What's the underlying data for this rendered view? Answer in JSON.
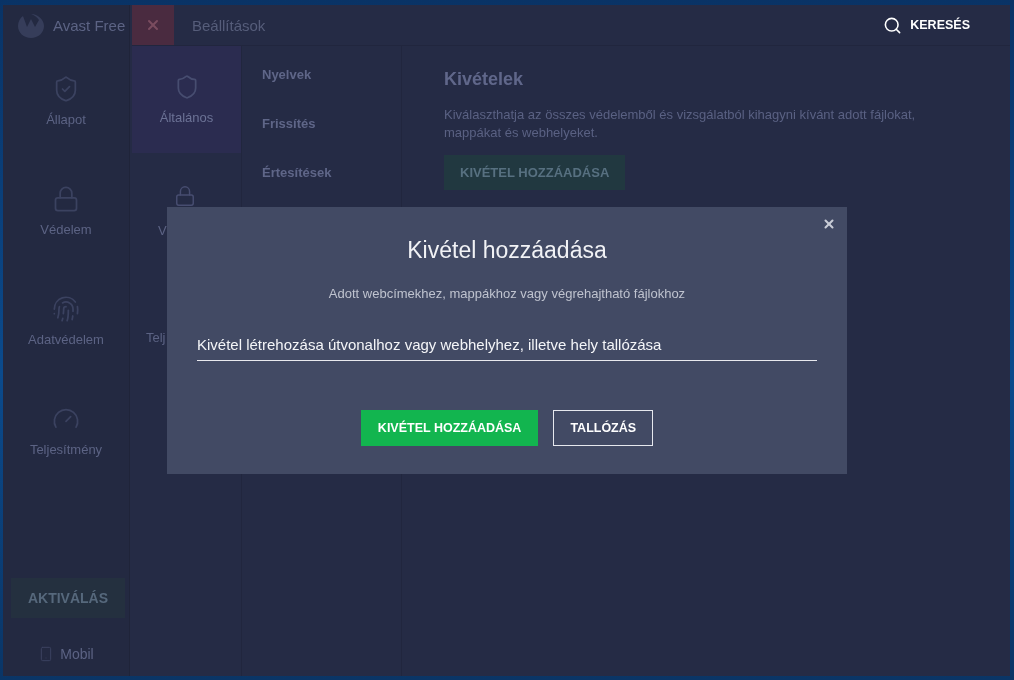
{
  "sidebar": {
    "brand": "Avast Free",
    "items": [
      {
        "label": "Állapot"
      },
      {
        "label": "Védelem"
      },
      {
        "label": "Adatvédelem"
      },
      {
        "label": "Teljesítmény"
      }
    ],
    "activate_button": "AKTIVÁLÁS",
    "mobile_link": "Mobil"
  },
  "top_bar": {
    "title": "Beállítások",
    "search": "KERESÉS"
  },
  "categories": [
    {
      "label": "Általános",
      "selected": true
    },
    {
      "label": "V",
      "selected": false
    },
    {
      "label": "Telj",
      "selected": false
    }
  ],
  "subcategories": [
    {
      "label": "Nyelvek",
      "selected": false
    },
    {
      "label": "Frissítés",
      "selected": false
    },
    {
      "label": "Értesítések",
      "selected": false
    }
  ],
  "exceptions": {
    "title": "Kivételek",
    "description": "Kiválaszthatja az összes védelemből és vizsgálatból kihagyni kívánt adott fájlokat, mappákat és webhelyeket.",
    "button": "KIVÉTEL HOZZÁADÁSA"
  },
  "dialog": {
    "title": "Kivétel hozzáadása",
    "subtitle": "Adott webcímekhez, mappákhoz vagy végrehajtható fájlokhoz",
    "input": {
      "placeholder": "Kivétel létrehozása útvonalhoz vagy webhelyhez, illetve hely tallózása"
    },
    "buttons": [
      {
        "label": "KIVÉTEL HOZZÁADÁSA",
        "kind": "primary"
      },
      {
        "label": "TALLÓZÁS",
        "kind": "secondary"
      }
    ]
  }
}
